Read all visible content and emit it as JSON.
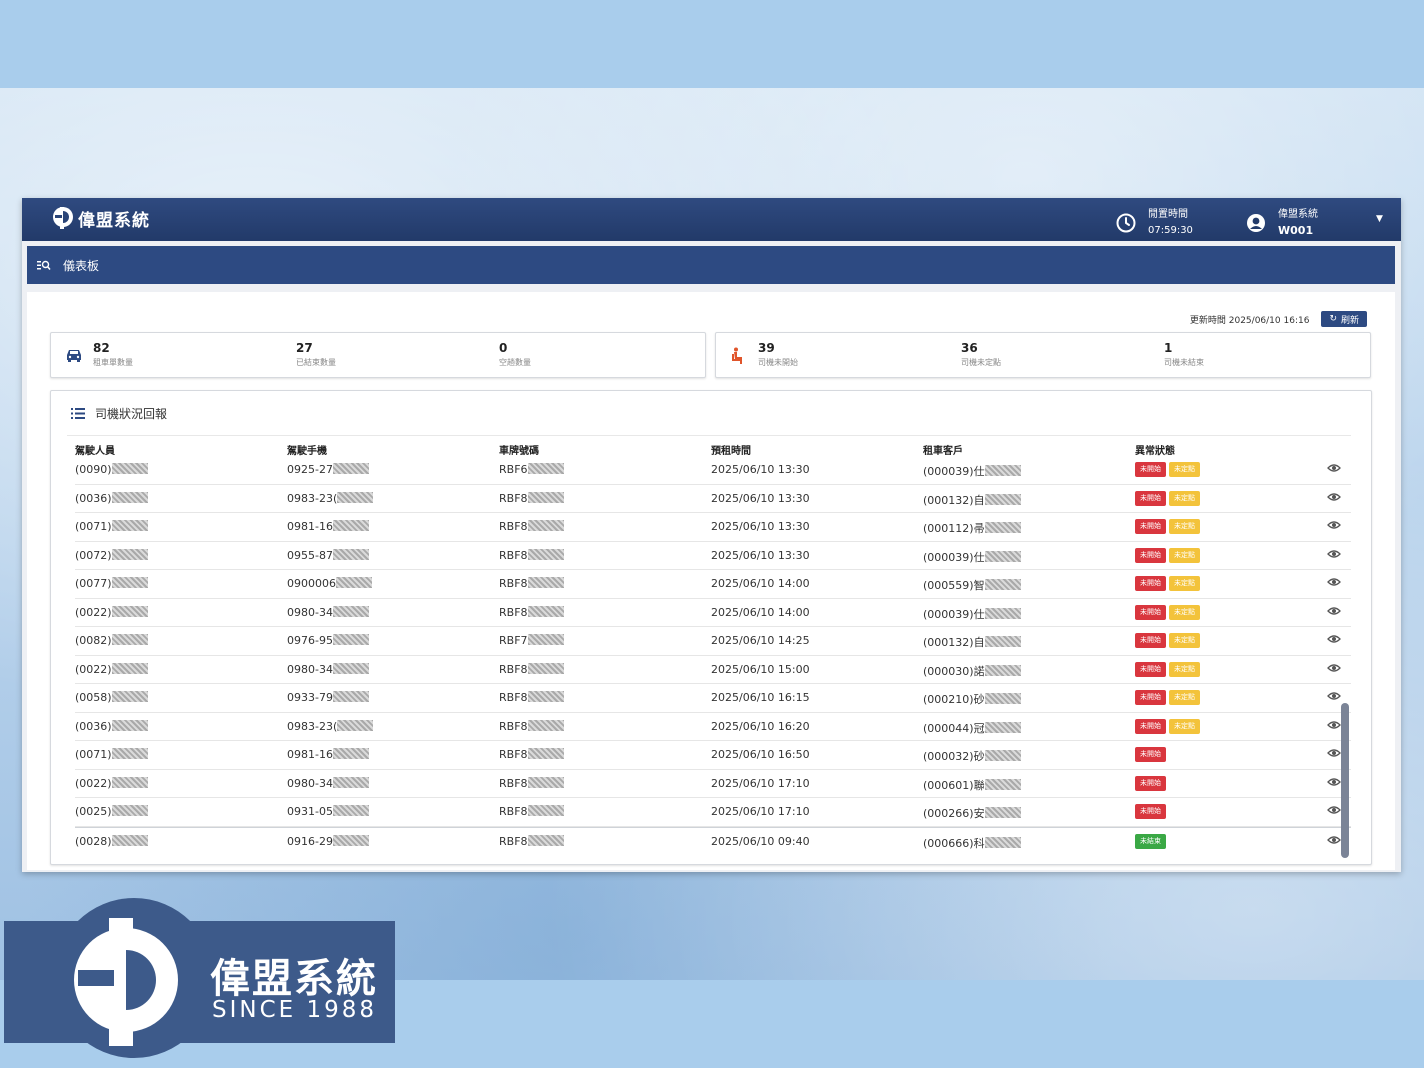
{
  "header": {
    "brand": "偉盟系統",
    "clock_label": "閒置時間",
    "clock_value": "07:59:30",
    "user_name": "偉盟系統",
    "user_id": "W001"
  },
  "breadcrumb": {
    "label": "儀表板"
  },
  "update": {
    "label": "更新時間 2025/06/10 16:16",
    "refresh_label": "刷新"
  },
  "stats_vehicle": [
    {
      "value": "82",
      "label": "租車單數量"
    },
    {
      "value": "27",
      "label": "已結束數量"
    },
    {
      "value": "0",
      "label": "空趟數量"
    }
  ],
  "stats_driver": [
    {
      "value": "39",
      "label": "司機未開始"
    },
    {
      "value": "36",
      "label": "司機未定點"
    },
    {
      "value": "1",
      "label": "司機未結束"
    }
  ],
  "panel": {
    "title": "司機狀況回報",
    "columns": [
      "駕駛人員",
      "駕駛手機",
      "車牌號碼",
      "預租時間",
      "租車客戶",
      "異常狀態"
    ]
  },
  "rows": [
    {
      "driver": "(0090)",
      "phone": "0925-27",
      "plate": "RBF6",
      "time": "2025/06/10 13:30",
      "customer": "(000039)仕",
      "badges": [
        "未開始",
        "未定點"
      ]
    },
    {
      "driver": "(0036)",
      "phone": "0983-23(",
      "plate": "RBF8",
      "time": "2025/06/10 13:30",
      "customer": "(000132)自",
      "badges": [
        "未開始",
        "未定點"
      ]
    },
    {
      "driver": "(0071)",
      "phone": "0981-16",
      "plate": "RBF8",
      "time": "2025/06/10 13:30",
      "customer": "(000112)帚",
      "badges": [
        "未開始",
        "未定點"
      ]
    },
    {
      "driver": "(0072)",
      "phone": "0955-87",
      "plate": "RBF8",
      "time": "2025/06/10 13:30",
      "customer": "(000039)仕",
      "badges": [
        "未開始",
        "未定點"
      ]
    },
    {
      "driver": "(0077)",
      "phone": "0900006",
      "plate": "RBF8",
      "time": "2025/06/10 14:00",
      "customer": "(000559)智",
      "badges": [
        "未開始",
        "未定點"
      ]
    },
    {
      "driver": "(0022)",
      "phone": "0980-34",
      "plate": "RBF8",
      "time": "2025/06/10 14:00",
      "customer": "(000039)仕",
      "badges": [
        "未開始",
        "未定點"
      ]
    },
    {
      "driver": "(0082)",
      "phone": "0976-95",
      "plate": "RBF7",
      "time": "2025/06/10 14:25",
      "customer": "(000132)自",
      "badges": [
        "未開始",
        "未定點"
      ]
    },
    {
      "driver": "(0022)",
      "phone": "0980-34",
      "plate": "RBF8",
      "time": "2025/06/10 15:00",
      "customer": "(000030)諾",
      "badges": [
        "未開始",
        "未定點"
      ]
    },
    {
      "driver": "(0058)",
      "phone": "0933-79",
      "plate": "RBF8",
      "time": "2025/06/10 16:15",
      "customer": "(000210)砂",
      "badges": [
        "未開始",
        "未定點"
      ]
    },
    {
      "driver": "(0036)",
      "phone": "0983-23(",
      "plate": "RBF8",
      "time": "2025/06/10 16:20",
      "customer": "(000044)冠",
      "badges": [
        "未開始",
        "未定點"
      ]
    },
    {
      "driver": "(0071)",
      "phone": "0981-16",
      "plate": "RBF8",
      "time": "2025/06/10 16:50",
      "customer": "(000032)砂",
      "badges": [
        "未開始"
      ]
    },
    {
      "driver": "(0022)",
      "phone": "0980-34",
      "plate": "RBF8",
      "time": "2025/06/10 17:10",
      "customer": "(000601)聯",
      "badges": [
        "未開始"
      ]
    },
    {
      "driver": "(0025)",
      "phone": "0931-05",
      "plate": "RBF8",
      "time": "2025/06/10 17:10",
      "customer": "(000266)安",
      "badges": [
        "未開始"
      ]
    },
    {
      "driver": "(0028)",
      "phone": "0916-29",
      "plate": "RBF8",
      "time": "2025/06/10 09:40",
      "customer": "(000666)科",
      "badges": [
        "未結束"
      ]
    }
  ],
  "badge_colors": {
    "未開始": "#d9363e",
    "未定點": "#f3c33b",
    "未結束": "#3aa845"
  },
  "logo": {
    "name": "偉盟系統",
    "since": "SINCE 1988"
  },
  "colors": {
    "navy": "#223a69",
    "accent": "#2d4a82",
    "background": "#a9cdec"
  }
}
